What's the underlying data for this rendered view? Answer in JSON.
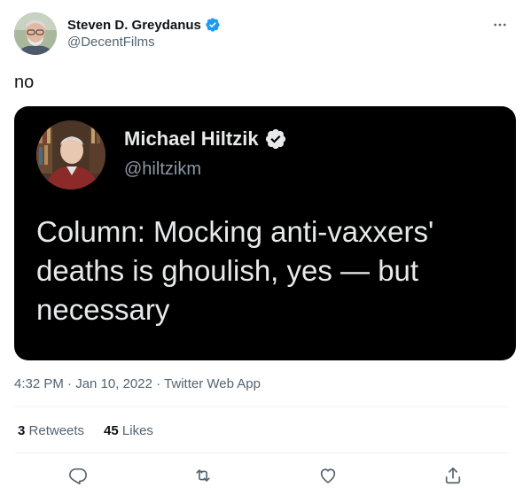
{
  "author": {
    "name": "Steven D. Greydanus",
    "handle": "@DecentFilms",
    "verified": true,
    "avatar_icon": "avatar-photo"
  },
  "tweet": {
    "text": "no"
  },
  "quoted_image": {
    "name": "Michael Hiltzik",
    "handle": "@hiltzikm",
    "verified": true,
    "headline": "Column: Mocking anti-vaxxers' deaths is ghoulish, yes — but necessary"
  },
  "meta": {
    "time": "4:32 PM",
    "separator": "·",
    "date": "Jan 10, 2022",
    "source": "Twitter Web App"
  },
  "stats": {
    "retweets_count": "3",
    "retweets_label": "Retweets",
    "likes_count": "45",
    "likes_label": "Likes"
  },
  "actions": [
    "reply-icon",
    "retweet-icon",
    "like-icon",
    "share-icon"
  ],
  "colors": {
    "accent": "#1d9bf0",
    "secondary_text": "#536471",
    "primary_text": "#0f1419",
    "card_bg": "#000000"
  }
}
